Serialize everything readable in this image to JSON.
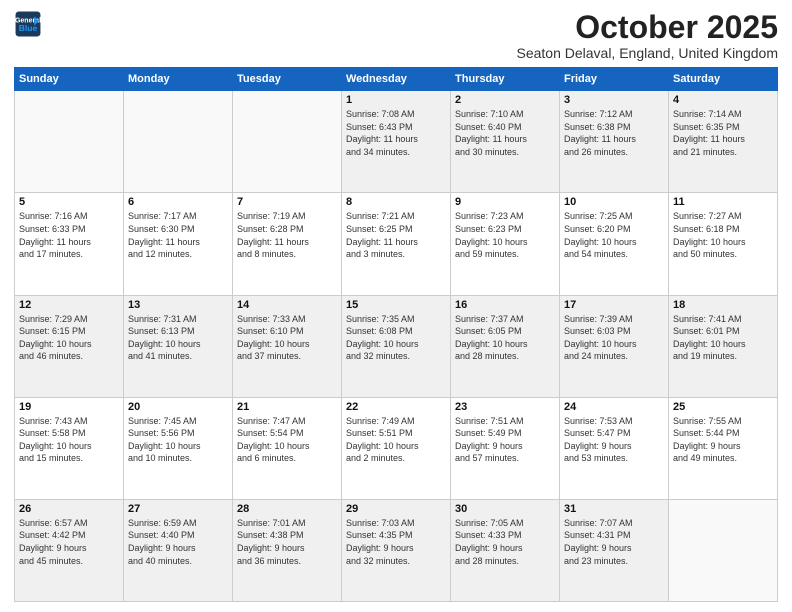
{
  "logo": {
    "line1": "General",
    "line2": "Blue"
  },
  "title": "October 2025",
  "location": "Seaton Delaval, England, United Kingdom",
  "weekdays": [
    "Sunday",
    "Monday",
    "Tuesday",
    "Wednesday",
    "Thursday",
    "Friday",
    "Saturday"
  ],
  "weeks": [
    [
      {
        "day": "",
        "info": ""
      },
      {
        "day": "",
        "info": ""
      },
      {
        "day": "",
        "info": ""
      },
      {
        "day": "1",
        "info": "Sunrise: 7:08 AM\nSunset: 6:43 PM\nDaylight: 11 hours\nand 34 minutes."
      },
      {
        "day": "2",
        "info": "Sunrise: 7:10 AM\nSunset: 6:40 PM\nDaylight: 11 hours\nand 30 minutes."
      },
      {
        "day": "3",
        "info": "Sunrise: 7:12 AM\nSunset: 6:38 PM\nDaylight: 11 hours\nand 26 minutes."
      },
      {
        "day": "4",
        "info": "Sunrise: 7:14 AM\nSunset: 6:35 PM\nDaylight: 11 hours\nand 21 minutes."
      }
    ],
    [
      {
        "day": "5",
        "info": "Sunrise: 7:16 AM\nSunset: 6:33 PM\nDaylight: 11 hours\nand 17 minutes."
      },
      {
        "day": "6",
        "info": "Sunrise: 7:17 AM\nSunset: 6:30 PM\nDaylight: 11 hours\nand 12 minutes."
      },
      {
        "day": "7",
        "info": "Sunrise: 7:19 AM\nSunset: 6:28 PM\nDaylight: 11 hours\nand 8 minutes."
      },
      {
        "day": "8",
        "info": "Sunrise: 7:21 AM\nSunset: 6:25 PM\nDaylight: 11 hours\nand 3 minutes."
      },
      {
        "day": "9",
        "info": "Sunrise: 7:23 AM\nSunset: 6:23 PM\nDaylight: 10 hours\nand 59 minutes."
      },
      {
        "day": "10",
        "info": "Sunrise: 7:25 AM\nSunset: 6:20 PM\nDaylight: 10 hours\nand 54 minutes."
      },
      {
        "day": "11",
        "info": "Sunrise: 7:27 AM\nSunset: 6:18 PM\nDaylight: 10 hours\nand 50 minutes."
      }
    ],
    [
      {
        "day": "12",
        "info": "Sunrise: 7:29 AM\nSunset: 6:15 PM\nDaylight: 10 hours\nand 46 minutes."
      },
      {
        "day": "13",
        "info": "Sunrise: 7:31 AM\nSunset: 6:13 PM\nDaylight: 10 hours\nand 41 minutes."
      },
      {
        "day": "14",
        "info": "Sunrise: 7:33 AM\nSunset: 6:10 PM\nDaylight: 10 hours\nand 37 minutes."
      },
      {
        "day": "15",
        "info": "Sunrise: 7:35 AM\nSunset: 6:08 PM\nDaylight: 10 hours\nand 32 minutes."
      },
      {
        "day": "16",
        "info": "Sunrise: 7:37 AM\nSunset: 6:05 PM\nDaylight: 10 hours\nand 28 minutes."
      },
      {
        "day": "17",
        "info": "Sunrise: 7:39 AM\nSunset: 6:03 PM\nDaylight: 10 hours\nand 24 minutes."
      },
      {
        "day": "18",
        "info": "Sunrise: 7:41 AM\nSunset: 6:01 PM\nDaylight: 10 hours\nand 19 minutes."
      }
    ],
    [
      {
        "day": "19",
        "info": "Sunrise: 7:43 AM\nSunset: 5:58 PM\nDaylight: 10 hours\nand 15 minutes."
      },
      {
        "day": "20",
        "info": "Sunrise: 7:45 AM\nSunset: 5:56 PM\nDaylight: 10 hours\nand 10 minutes."
      },
      {
        "day": "21",
        "info": "Sunrise: 7:47 AM\nSunset: 5:54 PM\nDaylight: 10 hours\nand 6 minutes."
      },
      {
        "day": "22",
        "info": "Sunrise: 7:49 AM\nSunset: 5:51 PM\nDaylight: 10 hours\nand 2 minutes."
      },
      {
        "day": "23",
        "info": "Sunrise: 7:51 AM\nSunset: 5:49 PM\nDaylight: 9 hours\nand 57 minutes."
      },
      {
        "day": "24",
        "info": "Sunrise: 7:53 AM\nSunset: 5:47 PM\nDaylight: 9 hours\nand 53 minutes."
      },
      {
        "day": "25",
        "info": "Sunrise: 7:55 AM\nSunset: 5:44 PM\nDaylight: 9 hours\nand 49 minutes."
      }
    ],
    [
      {
        "day": "26",
        "info": "Sunrise: 6:57 AM\nSunset: 4:42 PM\nDaylight: 9 hours\nand 45 minutes."
      },
      {
        "day": "27",
        "info": "Sunrise: 6:59 AM\nSunset: 4:40 PM\nDaylight: 9 hours\nand 40 minutes."
      },
      {
        "day": "28",
        "info": "Sunrise: 7:01 AM\nSunset: 4:38 PM\nDaylight: 9 hours\nand 36 minutes."
      },
      {
        "day": "29",
        "info": "Sunrise: 7:03 AM\nSunset: 4:35 PM\nDaylight: 9 hours\nand 32 minutes."
      },
      {
        "day": "30",
        "info": "Sunrise: 7:05 AM\nSunset: 4:33 PM\nDaylight: 9 hours\nand 28 minutes."
      },
      {
        "day": "31",
        "info": "Sunrise: 7:07 AM\nSunset: 4:31 PM\nDaylight: 9 hours\nand 23 minutes."
      },
      {
        "day": "",
        "info": ""
      }
    ]
  ]
}
